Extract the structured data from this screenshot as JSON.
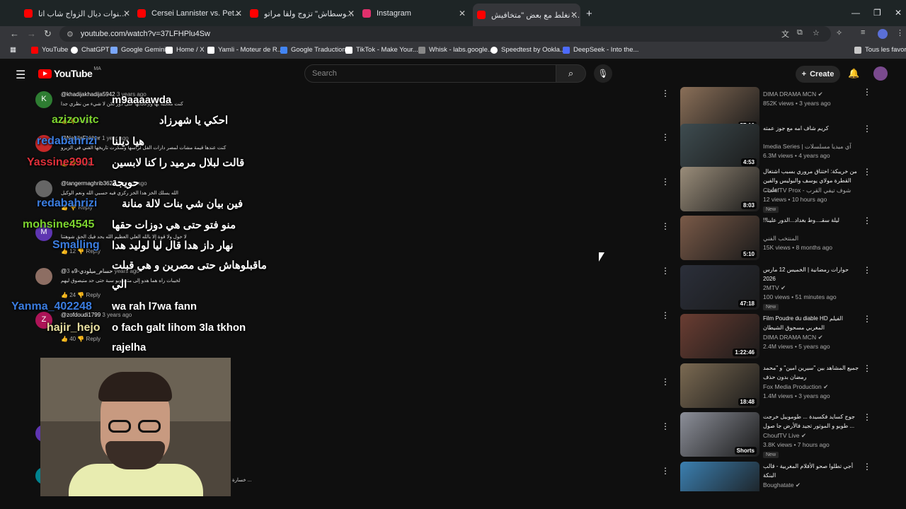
{
  "browser": {
    "tabs": [
      {
        "title": "بعد 9 سنوات ديال الزواج شاب اتا...",
        "icon_color": "#ff0000"
      },
      {
        "title": "Cersei Lannister vs. Petyr 'Littlefi...",
        "icon_color": "#ff0000"
      },
      {
        "title": "مول \"موسطاش\" تزوج ولقا مراتو...",
        "icon_color": "#ff0000"
      },
      {
        "title": "Instagram",
        "icon_color": "#e1306c"
      },
      {
        "title": "خايفه نغلط مع بعض \"متخافيش",
        "icon_color": "#ff0000"
      }
    ],
    "new_tab": "+",
    "close_glyph": "✕",
    "window_controls": {
      "minimize": "—",
      "restore": "❐",
      "close": "✕"
    },
    "url": "youtube.com/watch?v=37LFHPlu4Sw",
    "bookmarks": [
      {
        "label": "YouTube",
        "color": "#ff0000"
      },
      {
        "label": "ChatGPT",
        "color": "#ffffff"
      },
      {
        "label": "Google Gemini",
        "color": "#7aa7ff"
      },
      {
        "label": "Home / X",
        "color": "#ffffff"
      },
      {
        "label": "Yamli - Moteur de R...",
        "color": "#ffffff"
      },
      {
        "label": "Google Traduction",
        "color": "#4285f4"
      },
      {
        "label": "TikTok - Make Your...",
        "color": "#ffffff"
      },
      {
        "label": "Whisk - labs.google...",
        "color": "#888888"
      },
      {
        "label": "Speedtest by Ookla...",
        "color": "#ffffff"
      },
      {
        "label": "DeepSeek - Into the...",
        "color": "#4d6bfe"
      }
    ],
    "all_bookmarks": "Tous les favoris"
  },
  "youtube": {
    "logo": "YouTube",
    "country": "MA",
    "search_placeholder": "Search",
    "create_label": "Create"
  },
  "comments": [
    {
      "avatar_letter": "K",
      "avatar_color": "#2e7d32",
      "handle": "@khadijakhadija5942",
      "age": "3 years ago",
      "text": "كنت معجبة بها وبإعجابها على دور لكن لا شيء من نظري جدا",
      "likes": "",
      "reply": "Reply"
    },
    {
      "avatar_letter": "",
      "avatar_color": "#c62828",
      "handle": "@NabilaFakher",
      "age": "1 year ago",
      "text": "كنت عندها قيمة مشات لمصر دارات الفل لراسها وسكرت تاريخها الفني في الزيرو",
      "likes": "",
      "reply": "Reply"
    },
    {
      "avatar_letter": "",
      "avatar_color": "#666666",
      "handle": "@tangermaghrib3627",
      "age": "3 years ago",
      "text": "الله يسلك الخز هدا الخز ركزي فيه حسبي الله ونعم الوكيل",
      "likes": "",
      "reply": "Reply"
    },
    {
      "avatar_letter": "M",
      "avatar_color": "#5e35b1",
      "handle": "",
      "age": "",
      "text": "لا حول ولا قوة إلا بالله العلي العظيم الله يحد فيك الحق شوهتنا",
      "likes": "12",
      "reply": "Reply"
    },
    {
      "avatar_letter": "",
      "avatar_color": "#8d6e63",
      "handle": "@حسام_ميلودي-9ه",
      "age": "3 years ago",
      "text": "لخيبات راه هما هدو إلى متصاوبو سبة حتى حد متيصوق ليهم",
      "likes": "24",
      "reply": "Reply"
    },
    {
      "avatar_letter": "Z",
      "avatar_color": "#ad1457",
      "handle": "@zofdoudi1799",
      "age": "3 years ago",
      "text": "",
      "likes": "40",
      "reply": "Reply"
    }
  ],
  "bottom_comment_text": "خسارة ...",
  "chat_overlay": [
    {
      "name": "",
      "name_color": "#ffffff",
      "message": "m9aaaawda"
    },
    {
      "name": "azizovitc",
      "name_color": "#7cd32f",
      "message": "احكي يا شهرزاد"
    },
    {
      "name": "redabahrizi",
      "name_color": "#3b7de0",
      "message": "هيا ديلنا"
    },
    {
      "name": "Yassine2901",
      "name_color": "#e0303a",
      "message": "قالت لبلال مرميد را كنا لابسين"
    },
    {
      "name": "",
      "name_color": "#ffffff",
      "message": "حويجة"
    },
    {
      "name": "redabahrizi",
      "name_color": "#3b7de0",
      "message": "فين بيان شي بنات لالة منانة"
    },
    {
      "name": "mohsine4545",
      "name_color": "#7cd32f",
      "message": "منو فتو حتى هي دوزات حقها"
    },
    {
      "name": "Smalling",
      "name_color": "#3b7de0",
      "message": "نهار داز هدا قال ليا لوليد هدا"
    },
    {
      "name": "",
      "name_color": "#ffffff",
      "message": "ماقبلوهاش حتى مصرين و هي قبلت"
    },
    {
      "name": "",
      "name_color": "#ffffff",
      "message": "الي"
    },
    {
      "name": "Yanma_402248",
      "name_color": "#3b7de0",
      "message": "wa rah l7wa fann"
    },
    {
      "name": "hajir_hejo",
      "name_color": "#e8dfa0",
      "message": "o fach galt lihom 3la tkhon"
    },
    {
      "name": "",
      "name_color": "#ffffff",
      "message": "rajelha"
    }
  ],
  "recommendations": [
    {
      "title": "",
      "channel": "DIMA DRAMA MCN",
      "verified": true,
      "meta": "852K views • 3 years ago",
      "duration": "57:10",
      "new": "",
      "thumb": "#8a6f58",
      "rtl": false
    },
    {
      "title": "كريم شاف امه مع جوز عمته",
      "channel": "Imedia Series | آي ميديا مسلسلات",
      "verified": false,
      "meta": "6.3M views • 4 years ago",
      "duration": "4:53",
      "new": "",
      "thumb": "#3e4c50",
      "rtl": true
    },
    {
      "title": "من خريبكة: اختناق مروري بسبب اشتغال القطرة مولاي يوسف والبوليس والفين على...",
      "channel": "ChoufTV Prox - شوف تيفي القرب",
      "verified": false,
      "meta": "12 views • 10 hours ago",
      "duration": "8:03",
      "new": "New",
      "thumb": "#9a8d7a",
      "rtl": true
    },
    {
      "title": "ليلة سقـ...وط بغداد...الدور علينا!!",
      "channel": "المنتخب الفني",
      "verified": false,
      "meta": "15K views • 8 months ago",
      "duration": "5:10",
      "new": "",
      "thumb": "#7a5a48",
      "rtl": true
    },
    {
      "title": "حوارات رمضانية | الخميس 12 مارس 2026",
      "channel": "2MTV",
      "verified": true,
      "meta": "100 views • 51 minutes ago",
      "duration": "47:18",
      "new": "New",
      "thumb": "#2b2f3a",
      "rtl": true
    },
    {
      "title": "Film Poudre du diable HD الفيلم المغربي مسحوق الشيطان",
      "channel": "DIMA DRAMA MCN",
      "verified": true,
      "meta": "2.4M views • 5 years ago",
      "duration": "1:22:46",
      "new": "",
      "thumb": "#6a3d32",
      "rtl": false
    },
    {
      "title": "جميع المشاهد بين \"سيرين امين\" و \"محمد رمضان بدون حذف",
      "channel": "Fox Media Production",
      "verified": true,
      "meta": "1.4M views • 3 years ago",
      "duration": "18:48",
      "new": "",
      "thumb": "#7b6a52",
      "rtl": true
    },
    {
      "title": "جوج كسايد فكسيدة ... طوموبيل خرجت ... طوبو و الموتور تجيد فالأرض جا صول",
      "channel": "ChoufTV Live",
      "verified": true,
      "meta": "3.8K views • 7 hours ago",
      "duration": "Shorts",
      "new": "New",
      "thumb": "#8c8f99",
      "rtl": true
    },
    {
      "title": "أجي تطلوا صحو الأفلام المغربية - قالب البنكة",
      "channel": "Boughatate",
      "verified": true,
      "meta": "",
      "duration": "",
      "new": "",
      "thumb": "#3b7fb0",
      "rtl": true
    }
  ]
}
